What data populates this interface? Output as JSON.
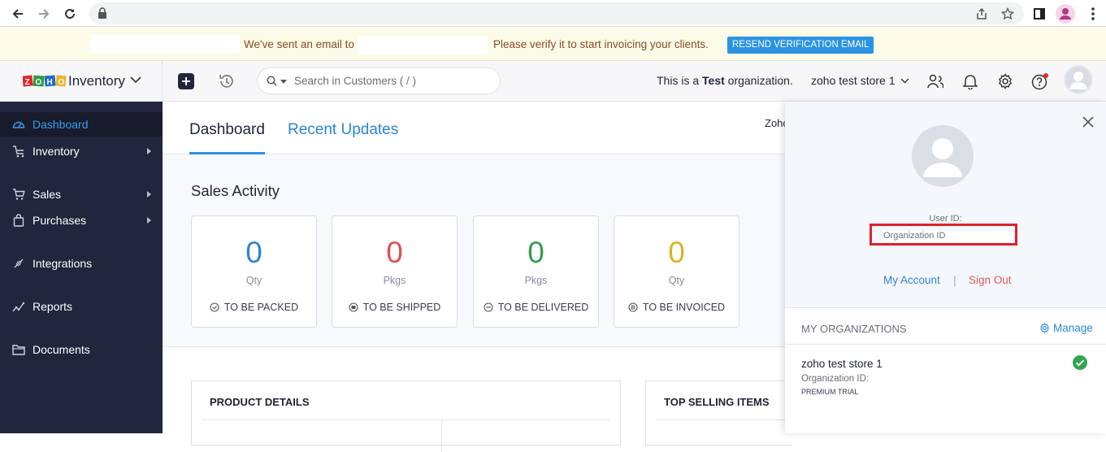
{
  "browser": {
    "back_icon": "arrow-left-icon",
    "forward_icon": "arrow-right-icon",
    "reload_icon": "reload-icon",
    "lock_icon": "lock-icon",
    "share_icon": "share-icon",
    "star_icon": "star-icon",
    "sidepanel_icon": "side-panel-icon",
    "profile_icon": "profile-icon",
    "menu_icon": "kebab-menu-icon"
  },
  "banner": {
    "text_before": "We've sent an email to",
    "text_after": "Please verify it to start invoicing your clients.",
    "button": "RESEND VERIFICATION EMAIL"
  },
  "header": {
    "app_name": "Inventory",
    "search_placeholder": "Search in Customers ( / )",
    "org_note_before": "This is a",
    "org_note_bold": "Test",
    "org_note_after": "organization.",
    "org_switcher": "zoho test store 1"
  },
  "sidebar": {
    "items": [
      {
        "label": "Dashboard",
        "icon": "dashboard-icon",
        "active": true
      },
      {
        "label": "Inventory",
        "icon": "inventory-icon",
        "arrow": true
      },
      {
        "label": "Sales",
        "icon": "cart-icon",
        "arrow": true
      },
      {
        "label": "Purchases",
        "icon": "bag-icon",
        "arrow": true
      },
      {
        "label": "Integrations",
        "icon": "integrations-icon"
      },
      {
        "label": "Reports",
        "icon": "reports-icon"
      },
      {
        "label": "Documents",
        "icon": "folder-icon"
      }
    ]
  },
  "main": {
    "tabs": [
      {
        "label": "Dashboard"
      },
      {
        "label": "Recent Updates"
      }
    ],
    "clipped_text": "Zoho",
    "sales_title": "Sales Activity",
    "cards": [
      {
        "value": "0",
        "unit": "Qty",
        "label": "TO BE PACKED",
        "color": "#2f83d8"
      },
      {
        "value": "0",
        "unit": "Pkgs",
        "label": "TO BE SHIPPED",
        "color": "#e05050"
      },
      {
        "value": "0",
        "unit": "Pkgs",
        "label": "TO BE DELIVERED",
        "color": "#3a9a4a"
      },
      {
        "value": "0",
        "unit": "Qty",
        "label": "TO BE INVOICED",
        "color": "#d9b32a"
      }
    ],
    "product_details": "PRODUCT DETAILS",
    "top_selling": "TOP SELLING ITEMS"
  },
  "drawer": {
    "user_id_label": "User ID:",
    "org_id_label": "Organization ID",
    "my_account": "My Account",
    "separator": "|",
    "sign_out": "Sign Out",
    "my_orgs": "MY ORGANIZATIONS",
    "manage": "Manage",
    "org_name": "zoho test store 1",
    "org_id_line": "Organization ID:",
    "plan": "PREMIUM TRIAL"
  },
  "colors": {
    "accent": "#2b93e4",
    "sidebar_bg": "#21263c",
    "sign_out": "#e05a5a",
    "highlight_box": "#e0202a",
    "check": "#2fa650"
  }
}
